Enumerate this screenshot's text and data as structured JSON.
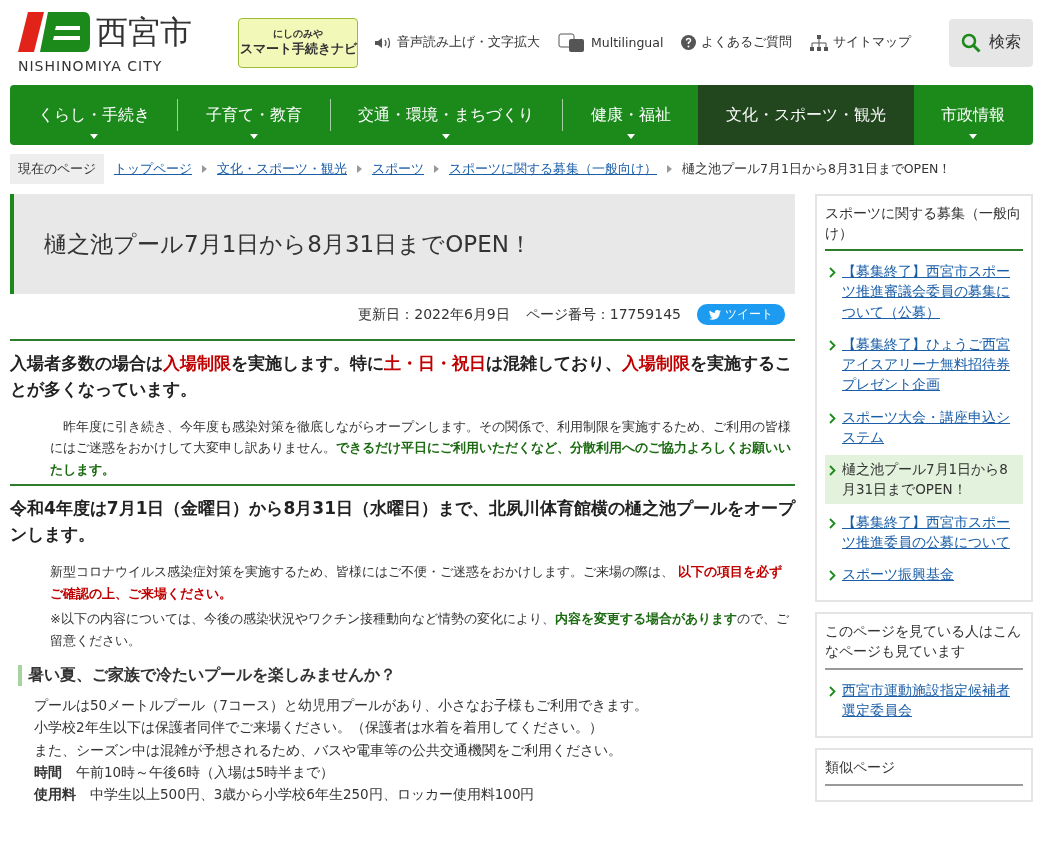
{
  "header": {
    "logo_kanji": "西宮市",
    "logo_roman": "NISHINOMIYA CITY",
    "navi_badge": {
      "line1": "にしのみや",
      "line2": "スマート手続きナビ"
    },
    "utility_links": [
      {
        "kind": "speaker",
        "label": "音声読み上げ・文字拡大"
      },
      {
        "kind": "translate",
        "label": "Multilingual"
      },
      {
        "kind": "help",
        "label": "よくあるご質問"
      },
      {
        "kind": "sitemap",
        "label": "サイトマップ"
      }
    ],
    "search_button": "検索"
  },
  "nav": [
    {
      "label": "くらし・手続き",
      "selected": false,
      "dropdown": true
    },
    {
      "label": "子育て・教育",
      "selected": false,
      "dropdown": true
    },
    {
      "label": "交通・環境・まちづくり",
      "selected": false,
      "dropdown": true
    },
    {
      "label": "健康・福祉",
      "selected": false,
      "dropdown": true
    },
    {
      "label": "文化・スポーツ・観光",
      "selected": true,
      "dropdown": false
    },
    {
      "label": "市政情報",
      "selected": false,
      "dropdown": true
    }
  ],
  "breadcrumb": {
    "label": "現在のページ",
    "links": [
      "トップページ",
      "文化・スポーツ・観光",
      "スポーツ",
      "スポーツに関する募集（一般向け）"
    ],
    "current": "樋之池プール7月1日から8月31日までOPEN！"
  },
  "page_title": "樋之池プール7月1日から8月31日までOPEN！",
  "meta": {
    "updated": "更新日：2022年6月9日",
    "page_number": "ページ番号：17759145",
    "tweet": "ツイート"
  },
  "sections": [
    {
      "kind": "heading",
      "segments": [
        {
          "text": "入場者多数の場合は"
        },
        {
          "text": "入場制限",
          "color": "#c00000"
        },
        {
          "text": "を実施します。特に"
        },
        {
          "text": "土・日・祝日",
          "color": "#c00000"
        },
        {
          "text": "は混雑しており、"
        },
        {
          "text": "入場制限",
          "color": "#c00000"
        },
        {
          "text": "を実施することが多くなっています。"
        }
      ]
    },
    {
      "kind": "paragraph",
      "segments": [
        {
          "text": "　昨年度に引き続き、今年度も感染対策を徹底しながらオープンします。その関係で、利用制限を実施するため、ご利用の皆様にはご迷惑をおかけして大変申し訳ありません。"
        },
        {
          "text": "できるだけ平日にご利用いただくなど、分散利用へのご協力よろしくお願いいたします。",
          "color": "#1c6b12"
        }
      ]
    },
    {
      "kind": "heading",
      "segments": [
        {
          "text": "令和4年度は7月1日（金曜日）から8月31日（水曜日）まで、北夙川体育館横の樋之池プールをオープンします。"
        }
      ]
    },
    {
      "kind": "paragraph",
      "segments": [
        {
          "text": "新型コロナウイルス感染症対策を実施するため、皆様にはご不便・ご迷惑をおかけします。ご来場の際は、 "
        },
        {
          "text": "以下の項目を必ずご確認の上、ご来場ください。",
          "color": "#c00000"
        }
      ]
    },
    {
      "kind": "paragraph",
      "segments": [
        {
          "text": "※以下の内容については、今後の感染状況やワクチン接種動向など情勢の変化により、"
        },
        {
          "text": "内容を変更する場合があります",
          "color": "#1c6b12"
        },
        {
          "text": "ので、ご留意ください。"
        }
      ]
    },
    {
      "kind": "subheading",
      "segments": [
        {
          "text": "暑い夏、ご家族で冷たいプールを楽しみませんか？"
        }
      ]
    },
    {
      "kind": "line",
      "segments": [
        {
          "text": "プールは50メートルプール（7コース）と幼児用プールがあり、小さなお子様もご利用できます。"
        }
      ]
    },
    {
      "kind": "line",
      "segments": [
        {
          "text": "小学校2年生以下は保護者同伴でご来場ください。（保護者は水着を着用してください。）"
        }
      ]
    },
    {
      "kind": "line",
      "segments": [
        {
          "text": "また、シーズン中は混雑が予想されるため、バスや電車等の公共交通機関をご利用ください。"
        }
      ]
    },
    {
      "kind": "field",
      "label": "時間",
      "value": "午前10時～午後6時（入場は5時半まで）"
    },
    {
      "kind": "field",
      "label": "使用料",
      "value": "中学生以上500円、3歳から小学校6年生250円、ロッカー使用料100円"
    }
  ],
  "sidebar": [
    {
      "title": "スポーツに関する募集（一般向け）",
      "color": "#2d7d2d",
      "items": [
        {
          "label": "【募集終了】西宮市スポーツ推進審議会委員の募集について（公募）",
          "selected": false
        },
        {
          "label": "【募集終了】ひょうご西宮アイスアリーナ無料招待券プレゼント企画",
          "selected": false
        },
        {
          "label": "スポーツ大会・講座申込システム",
          "selected": false
        },
        {
          "label": "樋之池プール7月1日から8月31日までOPEN！",
          "selected": true
        },
        {
          "label": "【募集終了】西宮市スポーツ推進委員の公募について",
          "selected": false
        },
        {
          "label": "スポーツ振興基金",
          "selected": false
        }
      ]
    },
    {
      "title": "このページを見ている人はこんなページも見ています",
      "color": "#999999",
      "items": [
        {
          "label": "西宮市運動施設指定候補者選定委員会",
          "selected": false
        }
      ]
    },
    {
      "title": "類似ページ",
      "color": "#999999"
    }
  ]
}
